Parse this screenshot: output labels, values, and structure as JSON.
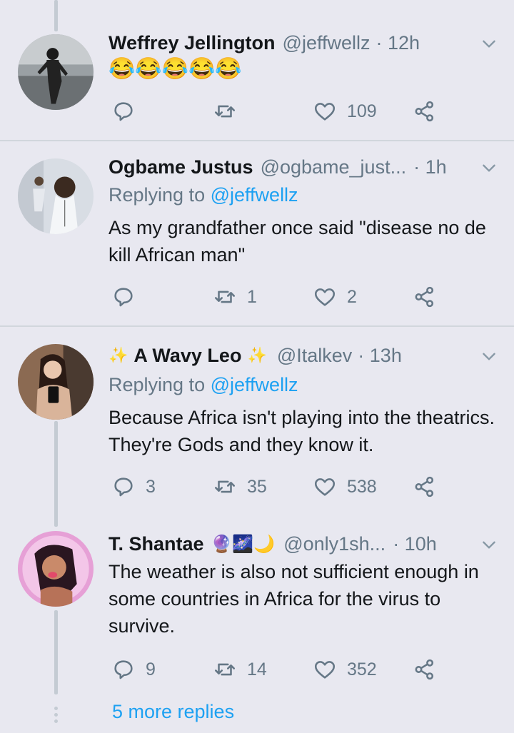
{
  "tweets": [
    {
      "name": "Weffrey Jellington",
      "handle": "@jeffwellz",
      "time": "· 12h",
      "text": "😂😂😂😂😂",
      "replying_label": "",
      "replying_to": "",
      "counts": {
        "reply": "",
        "retweet": "",
        "like": "109"
      }
    },
    {
      "name": "Ogbame Justus",
      "handle": "@ogbame_just...",
      "time": "· 1h",
      "replying_label": "Replying to",
      "replying_to": "@jeffwellz",
      "text": "As my grandfather once said \"disease no de kill African man\"",
      "counts": {
        "reply": "",
        "retweet": "1",
        "like": "2"
      }
    },
    {
      "name": "A Wavy Leo",
      "name_prefix": "✨",
      "name_suffix": "✨",
      "handle": "@Italkev",
      "time": "· 13h",
      "replying_label": "Replying to",
      "replying_to": "@jeffwellz",
      "text": "Because Africa isn't playing into the theatrics. They're Gods and they know it.",
      "counts": {
        "reply": "3",
        "retweet": "35",
        "like": "538"
      }
    },
    {
      "name": "T. Shantae",
      "name_emojis": "🔮🌌🌙",
      "handle": "@only1sh...",
      "time": "· 10h",
      "replying_label": "",
      "replying_to": "",
      "text": "The weather is also not sufficient enough in some countries in Africa for the virus to survive.",
      "counts": {
        "reply": "9",
        "retweet": "14",
        "like": "352"
      }
    }
  ],
  "more_replies": "5 more replies",
  "colors": {
    "background": "#e8e8f0",
    "link": "#1da1f2",
    "muted": "#657786",
    "text": "#14171a"
  },
  "icons": [
    "reply-icon",
    "retweet-icon",
    "like-icon",
    "share-icon",
    "chevron-down-icon"
  ]
}
